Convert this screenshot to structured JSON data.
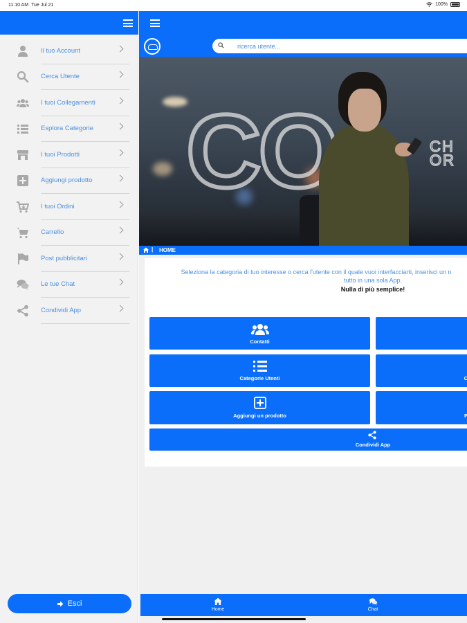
{
  "status": {
    "time": "11:10 AM",
    "date": "Tue Jul 21",
    "battery": "100%"
  },
  "sidebar": {
    "items": [
      {
        "label": "Il tuo Account",
        "icon": "user-icon"
      },
      {
        "label": "Cerca Utente",
        "icon": "search-icon"
      },
      {
        "label": "I tuoi Collegamenti",
        "icon": "users-icon"
      },
      {
        "label": "Esplora Categorie",
        "icon": "list-icon"
      },
      {
        "label": "I tuoi Prodotti",
        "icon": "store-icon"
      },
      {
        "label": "Aggiungi prodotto",
        "icon": "plus-square-icon"
      },
      {
        "label": "I tuoi Ordini",
        "icon": "cart-arrow-icon"
      },
      {
        "label": "Carrello",
        "icon": "cart-icon"
      },
      {
        "label": "Post pubblicitari",
        "icon": "flag-icon"
      },
      {
        "label": "Le tue Chat",
        "icon": "chat-icon"
      },
      {
        "label": "Condividi App",
        "icon": "share-icon"
      }
    ],
    "logout_label": "Esci"
  },
  "search": {
    "placeholder": "ricerca utente..."
  },
  "hero": {
    "big_text": "CO",
    "side_text_1": "CH",
    "side_text_2": "OR"
  },
  "breadcrumb": {
    "label": "HOME"
  },
  "intro": {
    "line1": "Seleziona la categoria di tuo interesse o cerca l'utente con il quale vuoi interfacciarti, inserisci un n",
    "line2": "tutto in una sola App.",
    "line3": "Nulla di più semplice!"
  },
  "tiles": {
    "contacts": "Contatti",
    "categories": "Categorie Utenti",
    "add_product": "Aggiungi un prodotto",
    "share": "Condividi App",
    "right2_partial": "C",
    "right3_partial": "P"
  },
  "bottomnav": {
    "home": "Home",
    "chat": "Chat"
  },
  "colors": {
    "primary": "#0a6efa",
    "link": "#4a90e2",
    "sidebar_bg": "#f2f2f2"
  }
}
